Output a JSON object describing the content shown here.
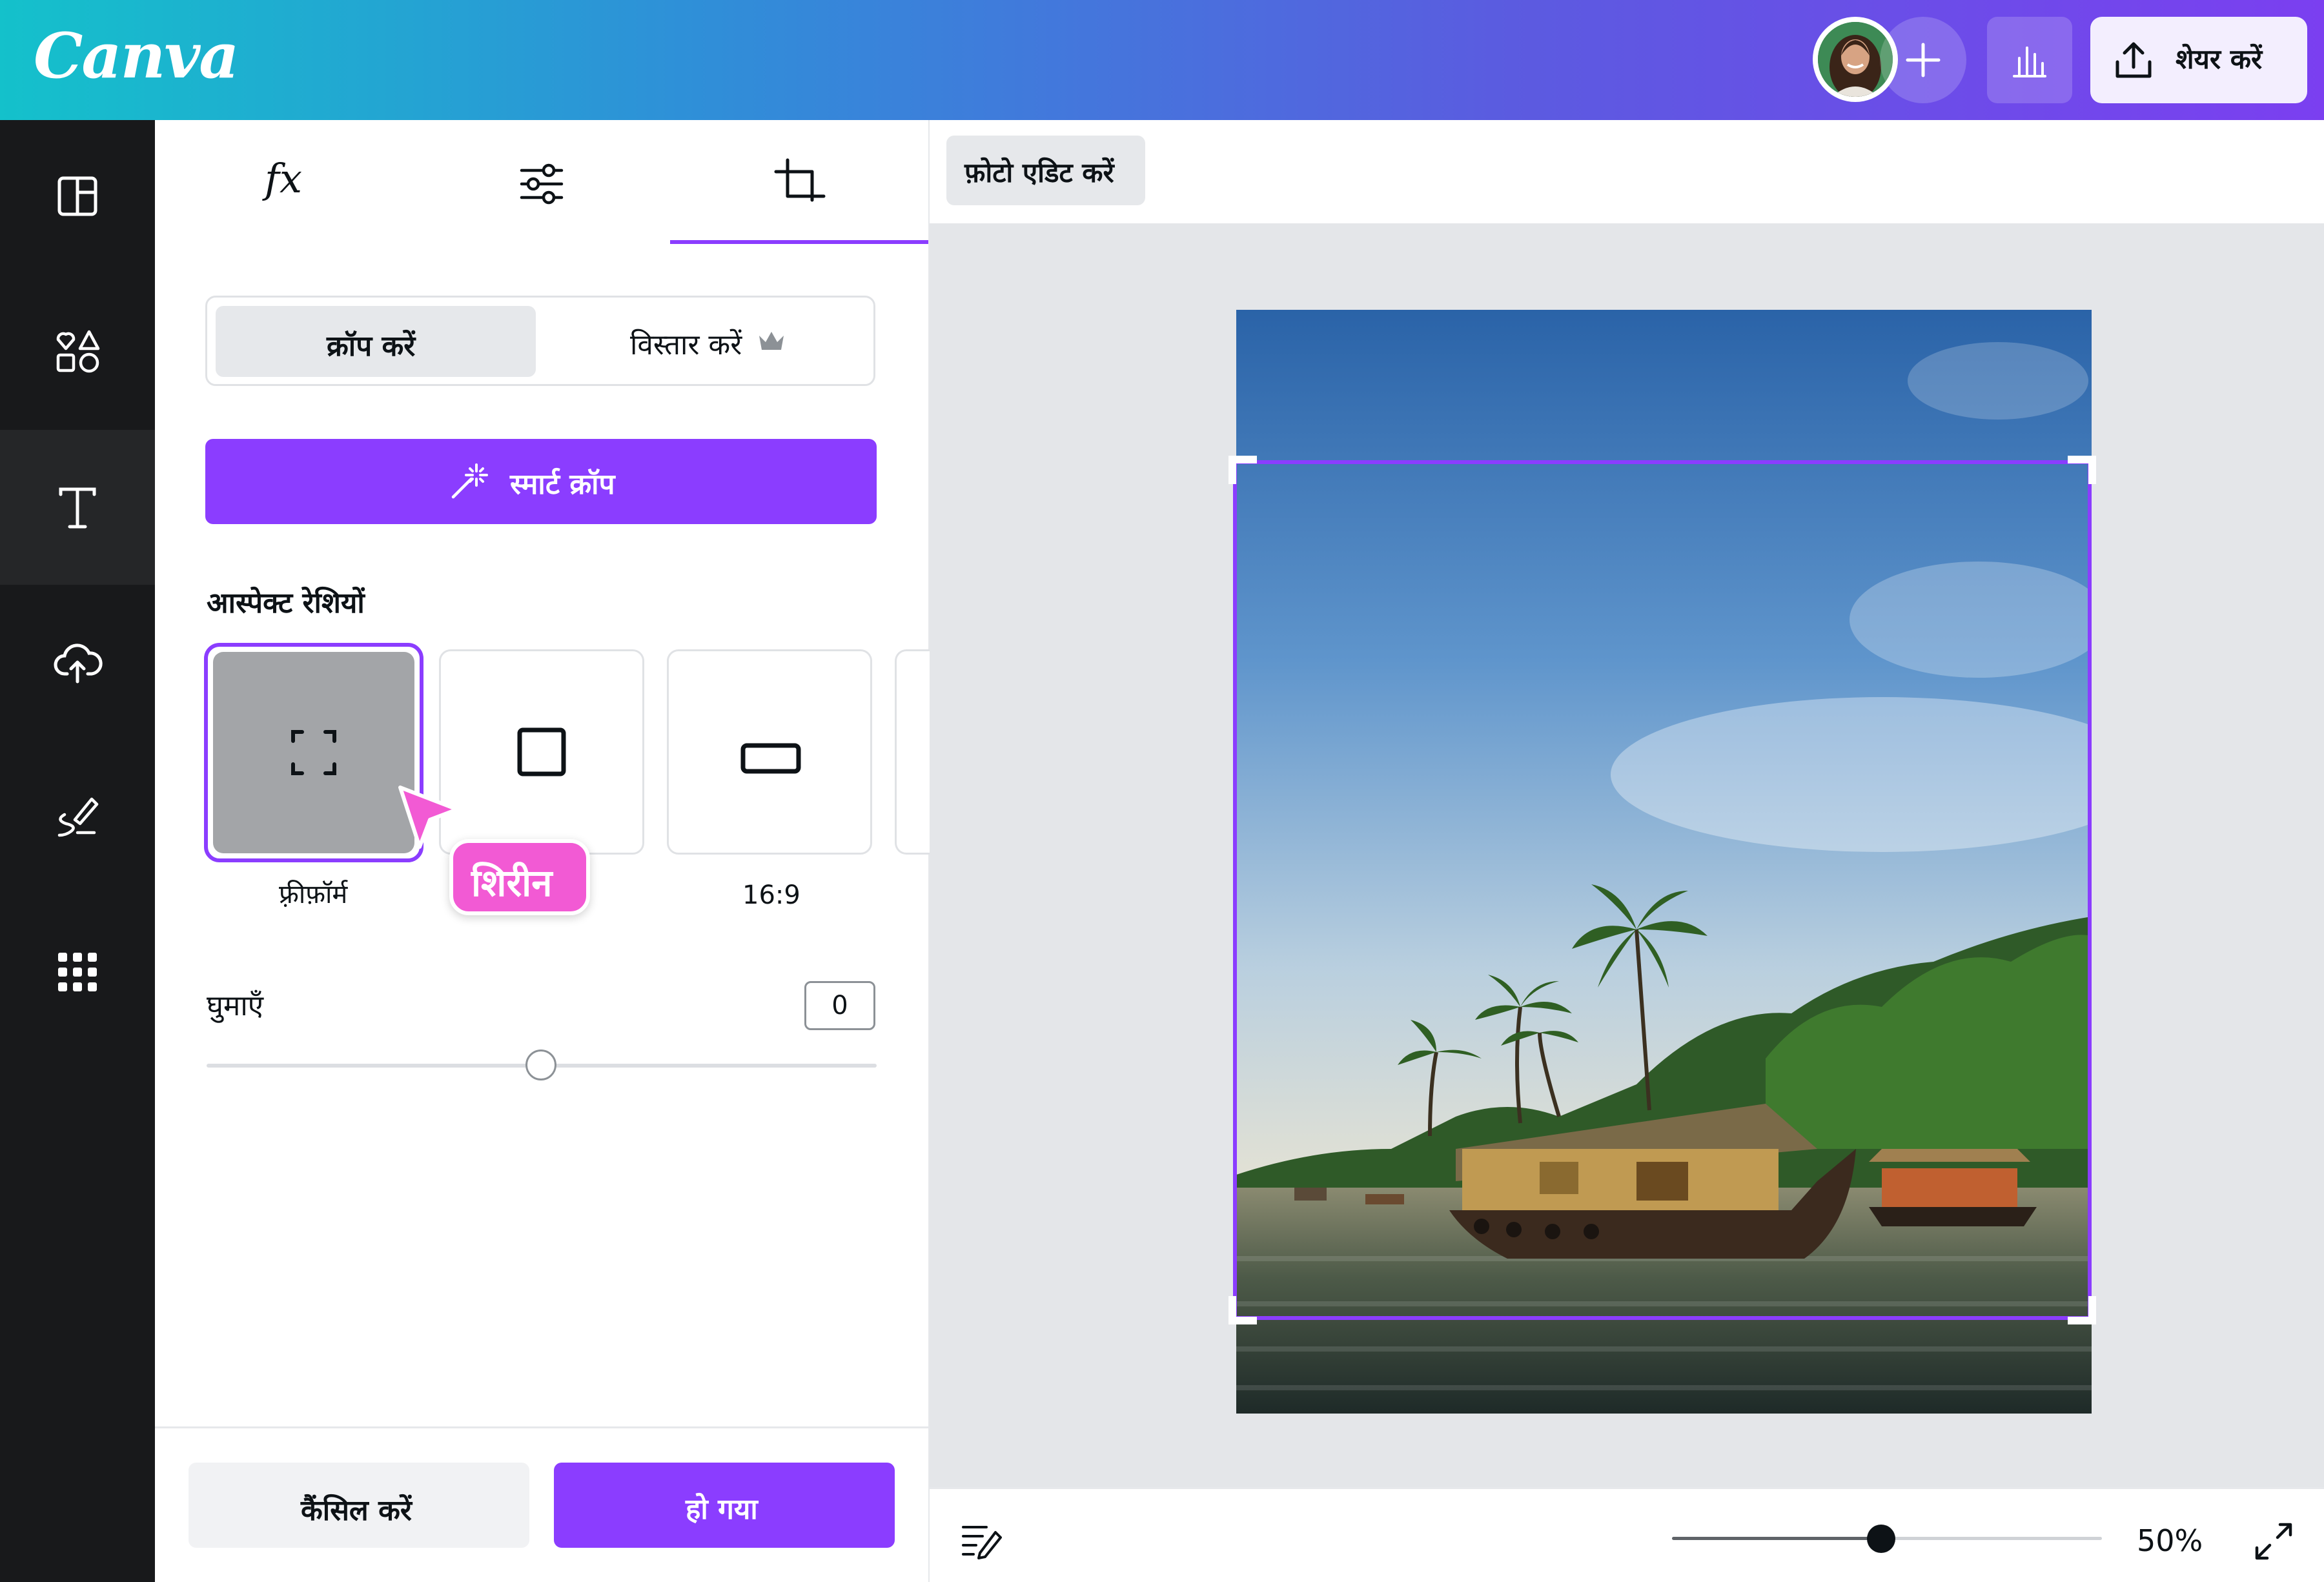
{
  "topbar": {
    "logo": "Canva",
    "share_label": "शेयर करें",
    "brand_color": "#8b3dff"
  },
  "rail": {
    "items": [
      {
        "name": "design",
        "icon": "layout-icon"
      },
      {
        "name": "elements",
        "icon": "shapes-icon"
      },
      {
        "name": "text",
        "icon": "text-icon"
      },
      {
        "name": "uploads",
        "icon": "cloud-upload-icon"
      },
      {
        "name": "draw",
        "icon": "draw-icon"
      },
      {
        "name": "apps",
        "icon": "apps-grid-icon"
      }
    ]
  },
  "panel": {
    "tabs": [
      {
        "label": "fx",
        "icon": "effects-icon"
      },
      {
        "label": "",
        "icon": "adjust-icon"
      },
      {
        "label": "",
        "icon": "crop-icon"
      }
    ],
    "segment": {
      "crop_label": "क्रॉप करें",
      "expand_label": "विस्तार करें"
    },
    "smart_crop_label": "स्मार्ट क्रॉप",
    "aspect_title": "आस्पेक्ट रेशियों",
    "aspect_options": [
      {
        "label": "फ़्रीफ़ॉर्म",
        "icon": "freeform-icon",
        "selected": true
      },
      {
        "label": "",
        "icon": "square-icon",
        "selected": false
      },
      {
        "label": "16:9",
        "icon": "wide-rect-icon",
        "selected": false
      }
    ],
    "collaborator_tag": "शिरीन",
    "rotate_label": "घुमाएँ",
    "rotate_value": "0",
    "rotate_fraction": 0.5,
    "cancel_label": "कैंसिल करें",
    "done_label": "हो गया"
  },
  "canvas": {
    "photo_edit_label": "फ़ोटो एडिट करें",
    "zoom_label": "50%",
    "zoom_fraction": 0.5
  }
}
